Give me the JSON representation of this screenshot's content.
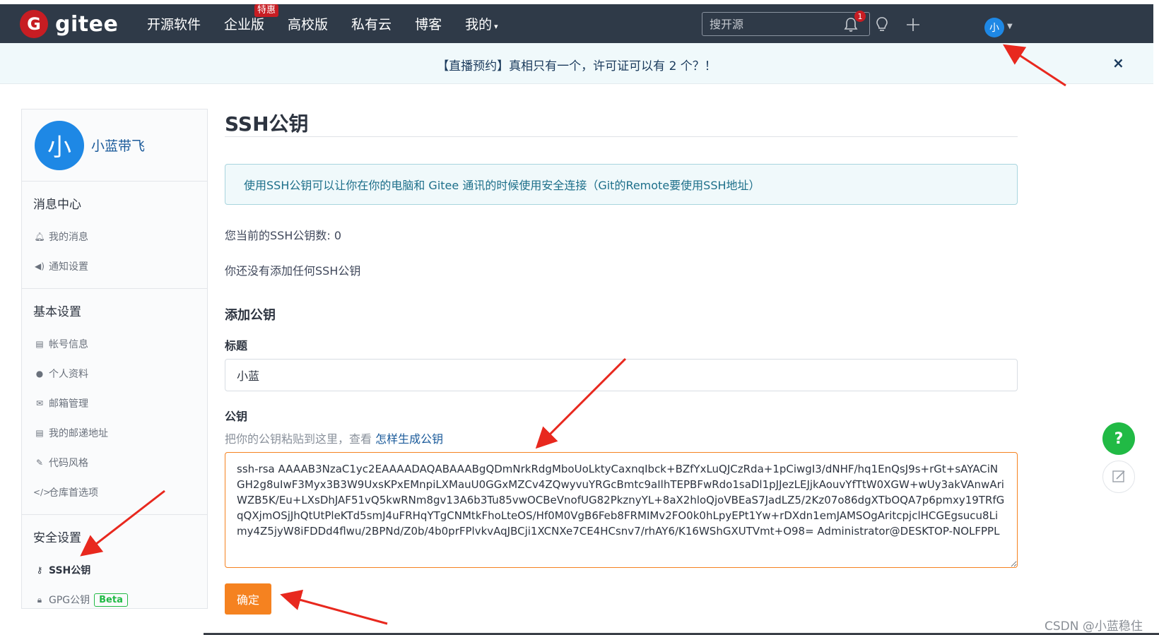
{
  "brand": {
    "logo_letter": "G",
    "name": "gitee"
  },
  "nav": {
    "links": [
      "开源软件",
      "企业版",
      "高校版",
      "私有云",
      "博客",
      "我的"
    ],
    "enterprise_badge": "特惠",
    "my_caret": "▾",
    "search_placeholder": "搜开源",
    "notification_count": "1",
    "avatar_letter": "小"
  },
  "banner": {
    "text": "【直播预约】真相只有一个，许可证可以有 2 个？！",
    "close": "×"
  },
  "sidebar": {
    "avatar_letter": "小",
    "username": "小蓝带飞",
    "sections": [
      {
        "title": "消息中心",
        "items": [
          {
            "label": "我的消息",
            "icon": "bell-icon"
          },
          {
            "label": "通知设置",
            "icon": "volume-icon"
          }
        ]
      },
      {
        "title": "基本设置",
        "items": [
          {
            "label": "帐号信息",
            "icon": "id-card-icon"
          },
          {
            "label": "个人资料",
            "icon": "user-icon"
          },
          {
            "label": "邮箱管理",
            "icon": "mail-icon"
          },
          {
            "label": "我的邮递地址",
            "icon": "address-card-icon"
          },
          {
            "label": "代码风格",
            "icon": "brush-icon"
          },
          {
            "label": "仓库首选项",
            "icon": "code-icon"
          }
        ]
      },
      {
        "title": "安全设置",
        "items": [
          {
            "label": "SSH公钥",
            "icon": "key-icon",
            "active": true
          },
          {
            "label": "GPG公钥",
            "icon": "lock-icon",
            "badge": "Beta"
          }
        ]
      }
    ]
  },
  "main": {
    "title": "SSH公钥",
    "info": "使用SSH公钥可以让你在你的电脑和 Gitee 通讯的时候使用安全连接（Git的Remote要使用SSH地址）",
    "count_text": "您当前的SSH公钥数: 0",
    "none_text": "你还没有添加任何SSH公钥",
    "add_title": "添加公钥",
    "title_label": "标题",
    "title_value": "小蓝",
    "key_label": "公钥",
    "key_hint": "把你的公钥粘贴到这里，查看",
    "key_hint_link": "怎样生成公钥",
    "key_value": "ssh-rsa AAAAB3NzaC1yc2EAAAADAQABAAABgQDmNrkRdgMboUoLktyCaxnqIbck+BZfYxLuQJCzRda+1pCiwgI3/dNHF/hq1EnQsJ9s+rGt+sAYACiNGH2g8uIwF3Myx3B3W9UxsKPxEMnpiLXMauU0GGxMZCv4ZQwyvuYRGcBmtc9aIlhTEPBFwRdo1saDl1pJJezLEJjkAouvYfTtW0XGW+wUy3akVAnwAriWZB5K/Eu+LXsDhJAF51vQ5kwRNm8gv13A6b3Tu85vwOCBeVnofUG82PkznyYL+8aX2hloQjoVBEaS7JadLZ5/2Kz07o86dgXTbOQA7p6pmxy19TRfGqQXjmOSjJhQtUtPleKTd5smJ4uFRHqYTgCNMtkFhoLteOS/Hf0M0VgB6Feb8FRMIMv2FO0k0hLpyEPt1Yw+rDXdn1emJAMSOgAritcpjclHCGEgsucu8Limy4Z5jyW8iFDDd4flwu/2BPNd/Z0b/4b0prFPlvkvAqJBCji1XCNXe7CE4HCsnv7/rhAY6/K16WShGXUTVmt+O98= Administrator@DESKTOP-NOLFPPL",
    "submit_label": "确定"
  },
  "floating": {
    "help": "?"
  },
  "watermark": "CSDN @小蓝稳住"
}
